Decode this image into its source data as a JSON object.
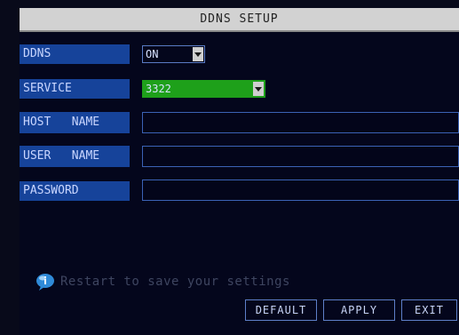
{
  "window": {
    "title": "DDNS SETUP"
  },
  "fields": {
    "ddns": {
      "label": "DDNS",
      "value": "ON"
    },
    "service": {
      "label": "SERVICE",
      "value": "3322"
    },
    "host_name": {
      "label": "HOST   NAME",
      "value": ""
    },
    "user_name": {
      "label": "USER   NAME",
      "value": ""
    },
    "password": {
      "label": "PASSWORD",
      "value": ""
    }
  },
  "hint": {
    "text": "Restart to save your settings",
    "icon": "info-icon"
  },
  "buttons": {
    "default": "DEFAULT",
    "apply": "APPLY",
    "exit": "EXIT"
  },
  "colors": {
    "background": "#04061c",
    "label_bg": "#16439a",
    "service_highlight": "#1ea01a",
    "title_bar": "#d2d2d2"
  }
}
